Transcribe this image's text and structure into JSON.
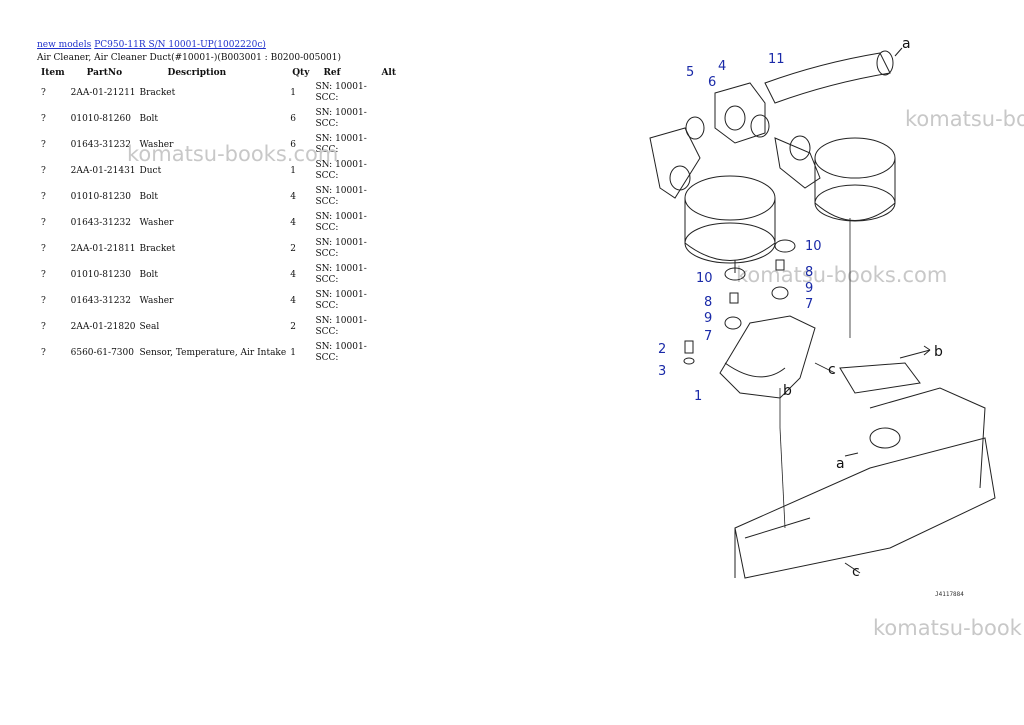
{
  "breadcrumb": {
    "link1": "new models",
    "link2": "PC950-11R S/N 10001-UP(1002220c)"
  },
  "subtitle": "Air Cleaner, Air Cleaner Duct(#10001-)(B003001 : B0200-005001)",
  "table": {
    "headers": {
      "item": "Item",
      "partno": "PartNo",
      "description": "Description",
      "qty": "Qty",
      "ref": "Ref",
      "alt": "Alt"
    },
    "rows": [
      {
        "item": "?",
        "partno": "2AA-01-21211",
        "description": "Bracket",
        "qty": "1",
        "ref": "SN: 10001-SCC:"
      },
      {
        "item": "?",
        "partno": "01010-81260",
        "description": "Bolt",
        "qty": "6",
        "ref": "SN: 10001-SCC:"
      },
      {
        "item": "?",
        "partno": "01643-31232",
        "description": "Washer",
        "qty": "6",
        "ref": "SN: 10001-SCC:"
      },
      {
        "item": "?",
        "partno": "2AA-01-21431",
        "description": "Duct",
        "qty": "1",
        "ref": "SN: 10001-SCC:"
      },
      {
        "item": "?",
        "partno": "01010-81230",
        "description": "Bolt",
        "qty": "4",
        "ref": "SN: 10001-SCC:"
      },
      {
        "item": "?",
        "partno": "01643-31232",
        "description": "Washer",
        "qty": "4",
        "ref": "SN: 10001-SCC:"
      },
      {
        "item": "?",
        "partno": "2AA-01-21811",
        "description": "Bracket",
        "qty": "2",
        "ref": "SN: 10001-SCC:"
      },
      {
        "item": "?",
        "partno": "01010-81230",
        "description": "Bolt",
        "qty": "4",
        "ref": "SN: 10001-SCC:"
      },
      {
        "item": "?",
        "partno": "01643-31232",
        "description": "Washer",
        "qty": "4",
        "ref": "SN: 10001-SCC:"
      },
      {
        "item": "?",
        "partno": "2AA-01-21820",
        "description": "Seal",
        "qty": "2",
        "ref": "SN: 10001-SCC:"
      },
      {
        "item": "?",
        "partno": "6560-61-7300",
        "description": "Sensor, Temperature, Air Intake",
        "qty": "1",
        "ref": "SN: 10001-SCC:"
      }
    ]
  },
  "watermark": "komatsu-books.com",
  "watermark_partial": "komatsu-boo",
  "watermark_partial2": "komatsu-book",
  "diagram": {
    "callouts": {
      "c1": "1",
      "c2": "2",
      "c3": "3",
      "c4": "4",
      "c5": "5",
      "c6": "6",
      "c7a": "7",
      "c7b": "7",
      "c8a": "8",
      "c8b": "8",
      "c9a": "9",
      "c9b": "9",
      "c10a": "10",
      "c10b": "10",
      "c11": "11"
    },
    "letters": {
      "a1": "a",
      "a2": "a",
      "b1": "b",
      "b2": "b",
      "c1": "c",
      "c2": "c"
    },
    "figure_code": "J4117884"
  },
  "colors": {
    "link": "#2233cc",
    "callout": "#1a2aa8",
    "watermark": "#c8c8c8"
  }
}
